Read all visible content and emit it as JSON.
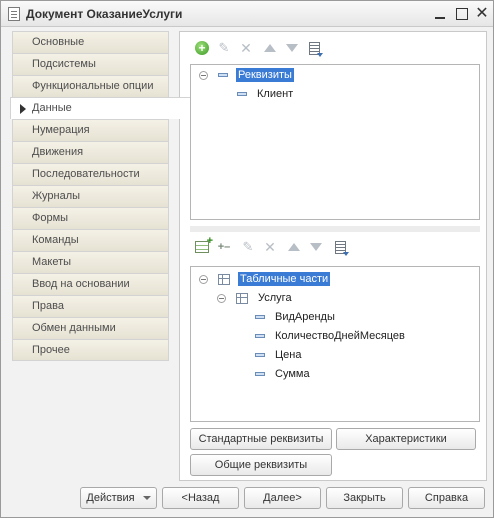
{
  "window": {
    "title": "Документ ОказаниеУслуги",
    "close_glyph": "✕"
  },
  "sidebar": {
    "items": [
      {
        "label": "Основные",
        "active": false
      },
      {
        "label": "Подсистемы",
        "active": false
      },
      {
        "label": "Функциональные опции",
        "active": false
      },
      {
        "label": "Данные",
        "active": true
      },
      {
        "label": "Нумерация",
        "active": false
      },
      {
        "label": "Движения",
        "active": false
      },
      {
        "label": "Последовательности",
        "active": false
      },
      {
        "label": "Журналы",
        "active": false
      },
      {
        "label": "Формы",
        "active": false
      },
      {
        "label": "Команды",
        "active": false
      },
      {
        "label": "Макеты",
        "active": false
      },
      {
        "label": "Ввод на основании",
        "active": false
      },
      {
        "label": "Права",
        "active": false
      },
      {
        "label": "Обмен данными",
        "active": false
      },
      {
        "label": "Прочее",
        "active": false
      }
    ]
  },
  "toolbar_icons": {
    "pencil": "✎",
    "cross": "✕",
    "add": "+",
    "sub": "+–"
  },
  "attributes_tree": {
    "root_label": "Реквизиты",
    "items": [
      "Клиент"
    ]
  },
  "tabular_tree": {
    "root_label": "Табличные части",
    "section_label": "Услуга",
    "items": [
      "ВидАренды",
      "КоличествоДнейМесяцев",
      "Цена",
      "Сумма"
    ]
  },
  "content_buttons": {
    "standard_attributes": "Стандартные реквизиты",
    "characteristics": "Характеристики",
    "common_attributes": "Общие реквизиты"
  },
  "bottom_buttons": {
    "actions": "Действия",
    "back": "<Назад",
    "next": "Далее>",
    "close": "Закрыть",
    "help": "Справка"
  },
  "colors": {
    "selection": "#3a7bd5",
    "sidebar_bg": "#e6e2d3",
    "add_icon": "#3c9a25"
  }
}
